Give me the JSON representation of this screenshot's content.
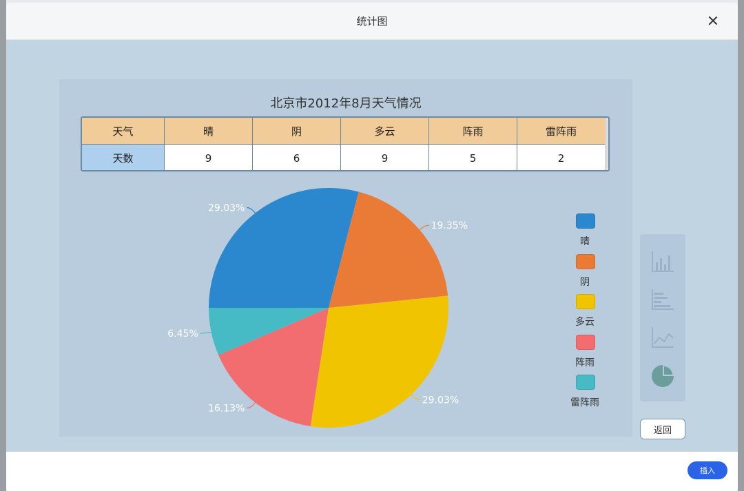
{
  "dialog": {
    "title": "统计图",
    "back_label": "返回",
    "insert_label": "插入"
  },
  "table": {
    "header_label": "天气",
    "row_label": "天数",
    "columns": [
      "晴",
      "阴",
      "多云",
      "阵雨",
      "雷阵雨"
    ],
    "values": [
      "9",
      "6",
      "9",
      "5",
      "2"
    ]
  },
  "chart_data": {
    "type": "pie",
    "title": "北京市2012年8月天气情况",
    "categories": [
      "晴",
      "阴",
      "多云",
      "阵雨",
      "雷阵雨"
    ],
    "values": [
      9,
      6,
      9,
      5,
      2
    ],
    "percent_labels": [
      "29.03%",
      "19.35%",
      "29.03%",
      "16.13%",
      "6.45%"
    ],
    "colors": [
      "#2b88cf",
      "#ea7b37",
      "#f0c400",
      "#f26d70",
      "#46bbc6"
    ],
    "legend_position": "right"
  },
  "side_toolbar": {
    "icons": [
      "column-chart-icon",
      "bar-chart-icon",
      "line-chart-icon",
      "pie-chart-icon"
    ]
  }
}
